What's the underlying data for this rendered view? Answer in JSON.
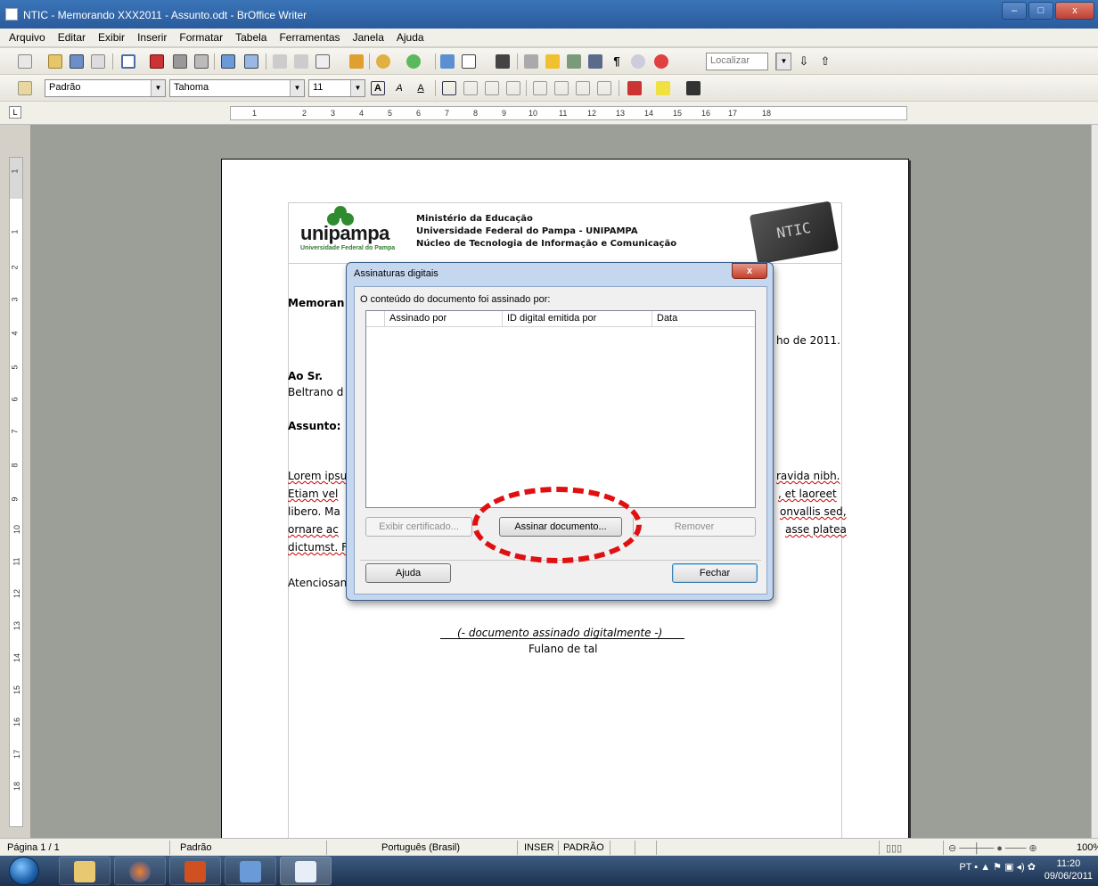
{
  "window": {
    "title": "NTIC - Memorando XXX2011 - Assunto.odt - BrOffice Writer",
    "minimize": "–",
    "maximize": "□",
    "close": "x"
  },
  "menu": [
    "Arquivo",
    "Editar",
    "Exibir",
    "Inserir",
    "Formatar",
    "Tabela",
    "Ferramentas",
    "Janela",
    "Ajuda"
  ],
  "toolbar": {
    "find_placeholder": "Localizar",
    "paragraph_style": "Padrão",
    "font_name": "Tahoma",
    "font_size": "11"
  },
  "ruler": {
    "h_marks": [
      "1",
      "2",
      "3",
      "4",
      "5",
      "6",
      "7",
      "8",
      "9",
      "10",
      "11",
      "12",
      "13",
      "14",
      "15",
      "16",
      "17",
      "18"
    ],
    "v_marks": [
      "1",
      "1",
      "2",
      "3",
      "4",
      "5",
      "6",
      "7",
      "8",
      "9",
      "10",
      "11",
      "12",
      "13",
      "14",
      "15",
      "16",
      "17",
      "18"
    ]
  },
  "document": {
    "logo_text": "unipampa",
    "logo_sub": "Universidade Federal do Pampa",
    "institution": [
      "Ministério da Educação",
      "Universidade Federal do Pampa - UNIPAMPA",
      "Núcleo de Tecnologia de Informação e Comunicação"
    ],
    "badge": "NTIC",
    "memo_heading": "Memoran",
    "date_fragment": "ho de 2011.",
    "to_label": "Ao Sr.",
    "to_name": "Beltrano d",
    "subject_label": "Assunto:",
    "body_left": [
      "Lorem ipsu",
      "Etiam vel",
      "libero. Ma",
      "ornare ac",
      "dictumst. F"
    ],
    "body_right": [
      "ravida nibh.",
      ", et laoreet",
      "onvallis sed,",
      "asse platea"
    ],
    "closing": "Atenciosan",
    "signature_note": "(- documento assinado digitalmente -)",
    "signer": "Fulano de tal"
  },
  "dialog": {
    "title": "Assinaturas digitais",
    "close": "x",
    "label": "O conteúdo do documento foi assinado por:",
    "columns": [
      "Assinado por",
      "ID digital emitida por",
      "Data"
    ],
    "btn_view_cert": "Exibir certificado...",
    "btn_sign": "Assinar documento...",
    "btn_remove": "Remover",
    "btn_help": "Ajuda",
    "btn_close": "Fechar"
  },
  "statusbar": {
    "page": "Página 1 / 1",
    "style": "Padrão",
    "language": "Português (Brasil)",
    "mode": "INSER",
    "selection": "PADRÃO",
    "zoom": "100%"
  },
  "taskbar": {
    "lang": "PT",
    "time": "11:20",
    "date": "09/06/2011"
  },
  "colors": {
    "annotation": "#e01010",
    "titlebar": "#2a5b9c"
  }
}
